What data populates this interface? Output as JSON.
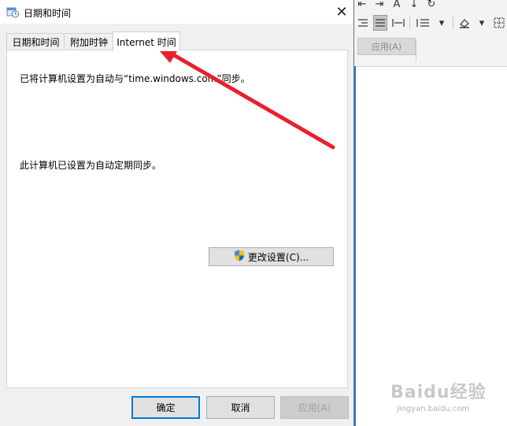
{
  "dialog": {
    "title": "日期和时间",
    "close_glyph": "✕",
    "tabs": [
      "日期和时间",
      "附加时钟",
      "Internet 时间"
    ],
    "active_tab": "Internet 时间",
    "sync_message": "已将计算机设置为自动与“time.windows.com”同步。",
    "auto_message": "此计算机已设置为自动定期同步。",
    "change_settings_label": "更改设置(C)...",
    "ok_label": "确定",
    "cancel_label": "取消",
    "apply_label": "应用(A)"
  },
  "background_app": {
    "apply_label": "应用(A)"
  },
  "watermark": {
    "brand": "Baidu经验",
    "sub": "jingyan.baidu.com"
  },
  "colors": {
    "annotation_arrow": "#e8202e",
    "focus_border": "#0078d7",
    "doc_border": "#2b7cd3"
  },
  "icons": [
    "datetime-settings-icon",
    "close-icon",
    "uac-shield-icon"
  ]
}
